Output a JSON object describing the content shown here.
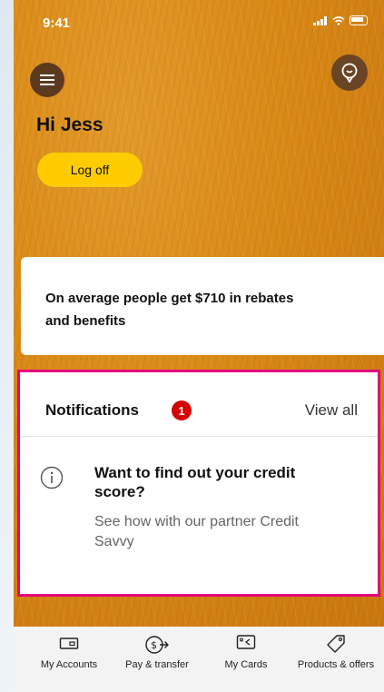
{
  "status_bar": {
    "time": "9:41"
  },
  "header": {
    "greeting": "Hi Jess",
    "logoff_label": "Log off"
  },
  "rebate_card": {
    "text": "On average people get $710 in rebates and benefits"
  },
  "notifications": {
    "title": "Notifications",
    "count": "1",
    "view_all_label": "View all",
    "items": [
      {
        "icon": "info-icon",
        "heading": "Want to find out your credit score?",
        "body": "See how with our partner Credit Savvy"
      }
    ]
  },
  "tab_bar": {
    "items": [
      {
        "label": "My Accounts",
        "icon": "wallet-icon"
      },
      {
        "label": "Pay & transfer",
        "icon": "pay-transfer-icon"
      },
      {
        "label": "My Cards",
        "icon": "cards-icon"
      },
      {
        "label": "Products & offers",
        "icon": "tag-icon"
      }
    ]
  },
  "colors": {
    "brand_yellow": "#ffcc00",
    "highlight_border": "#e6007e",
    "badge_red": "#d50000"
  }
}
